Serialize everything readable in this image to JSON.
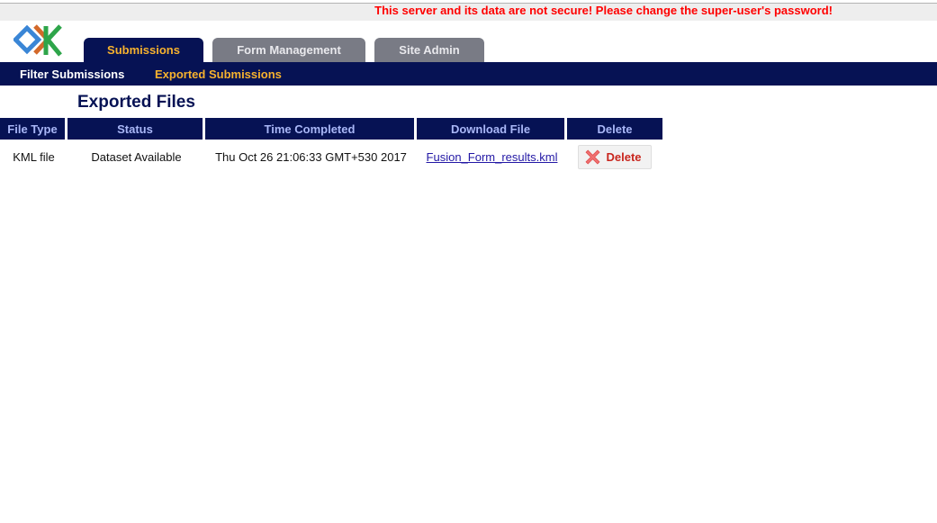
{
  "warning": {
    "text": "This server and its data are not secure! Please change the super-user's password!",
    "color": "#ff0000"
  },
  "logo": {
    "icon": "odk-logo-icon"
  },
  "tabs": [
    {
      "label": "Submissions",
      "active": true
    },
    {
      "label": "Form Management",
      "active": false
    },
    {
      "label": "Site Admin",
      "active": false
    }
  ],
  "subnav": [
    {
      "label": "Filter Submissions",
      "current": false
    },
    {
      "label": "Exported Submissions",
      "current": true
    }
  ],
  "page_title": "Exported Files",
  "table": {
    "headers": [
      "File Type",
      "Status",
      "Time Completed",
      "Download File",
      "Delete"
    ],
    "rows": [
      {
        "file_type": "KML file",
        "status": "Dataset Available",
        "time_completed": "Thu Oct 26 21:06:33 GMT+530 2017",
        "download_file": "Fusion_Form_results.kml",
        "delete_label": "Delete",
        "delete_icon": "x-icon"
      }
    ]
  },
  "colors": {
    "navy": "#061254",
    "accent_orange": "#f7b22e",
    "tab_inactive": "#797b85",
    "header_text": "#a9b7f7",
    "delete_red": "#c8261e"
  }
}
